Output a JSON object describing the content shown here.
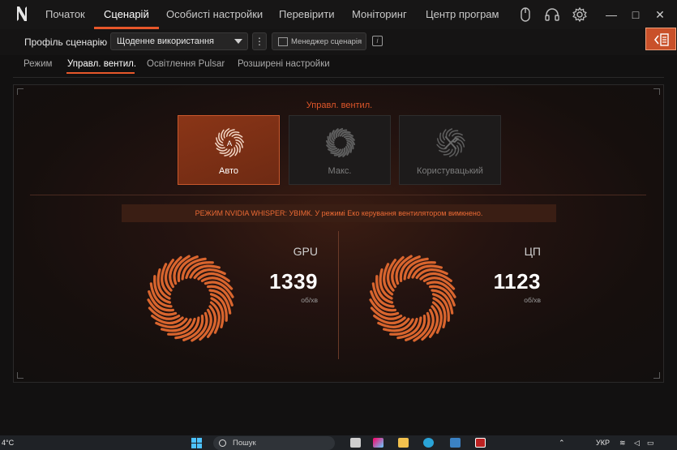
{
  "app": {
    "nav": [
      "Початок",
      "Сценарій",
      "Особисті настройки",
      "Перевірити",
      "Моніторинг",
      "Центр програм"
    ],
    "active_nav": "Сценарій",
    "window_controls": {
      "minimize": "—",
      "maximize": "□",
      "close": "✕"
    }
  },
  "profile": {
    "label": "Профіль сценарію",
    "selected": "Щоденне використання",
    "menu_dots": "⋮",
    "manager_label": "Менеджер сценарія",
    "info": "i"
  },
  "subtabs": [
    "Режим",
    "Управл. вентил.",
    "Освітлення Pulsar",
    "Розширені настройки"
  ],
  "active_subtab": "Управл. вентил.",
  "fan_control": {
    "title": "Управл. вентил.",
    "modes": [
      {
        "label": "Авто",
        "icon": "fan-auto-icon",
        "active": true
      },
      {
        "label": "Макс.",
        "icon": "fan-max-icon",
        "active": false
      },
      {
        "label": "Користувацький",
        "icon": "fan-custom-icon",
        "active": false
      }
    ],
    "warning": "РЕЖИМ NVIDIA WHISPER: УВІМК. У режимі Еко керування вентилятором вимкнено."
  },
  "fans": {
    "gpu": {
      "name": "GPU",
      "rpm": "1339",
      "unit": "об/хв"
    },
    "cpu": {
      "name": "ЦП",
      "rpm": "1123",
      "unit": "об/хв"
    }
  },
  "taskbar": {
    "temp": "4°C",
    "search_placeholder": "Пошук",
    "lang": "УКР"
  },
  "colors": {
    "accent": "#e8572a",
    "warning_text": "#ec6a34",
    "active_card": "#8a3517"
  }
}
